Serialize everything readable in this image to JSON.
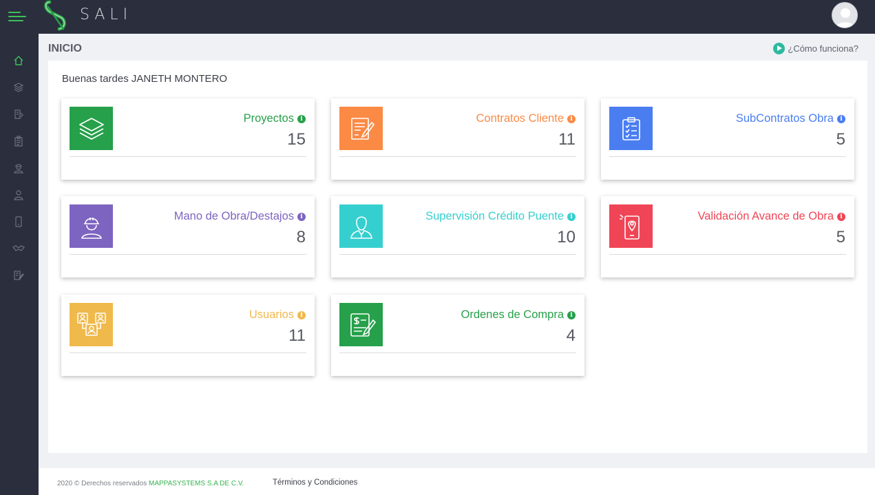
{
  "app": {
    "name": "SALI"
  },
  "header": {
    "page_title": "INICIO",
    "help_link": "¿Cómo funciona?"
  },
  "greeting": "Buenas tardes JANETH MONTERO",
  "cards": [
    {
      "title": "Proyectos",
      "count": "15",
      "color": "#26a04a",
      "icon": "layers-icon"
    },
    {
      "title": "Contratos Cliente",
      "count": "11",
      "color": "#fb8a45",
      "icon": "contract-icon"
    },
    {
      "title": "SubContratos Obra",
      "count": "5",
      "color": "#4a7ef0",
      "icon": "clipboard-checklist-icon"
    },
    {
      "title": "Mano de Obra/Destajos",
      "count": "8",
      "color": "#7d64c1",
      "icon": "worker-icon"
    },
    {
      "title": "Supervisión Crédito Puente",
      "count": "10",
      "color": "#36cfcf",
      "icon": "supervisor-icon"
    },
    {
      "title": "Validación Avance de Obra",
      "count": "5",
      "color": "#ef4556",
      "icon": "phone-location-icon"
    },
    {
      "title": "Usuarios",
      "count": "11",
      "color": "#f0b94c",
      "icon": "users-icon"
    },
    {
      "title": "Ordenes de Compra",
      "count": "4",
      "color": "#26a04a",
      "icon": "purchase-order-icon"
    }
  ],
  "sidebar": {
    "items": [
      {
        "icon": "home-icon",
        "active": true
      },
      {
        "icon": "layers-icon"
      },
      {
        "icon": "contract-icon"
      },
      {
        "icon": "clipboard-icon"
      },
      {
        "icon": "worker-icon"
      },
      {
        "icon": "supervisor-icon"
      },
      {
        "icon": "phone-icon"
      },
      {
        "icon": "handshake-icon"
      },
      {
        "icon": "edit-document-icon"
      }
    ]
  },
  "footer": {
    "copyright": "2020 © Derechos reservados",
    "company": "MAPPASYSTEMS S.A DE C.V.",
    "terms": "Términos y Condiciones"
  },
  "colors": {
    "brand_green": "#3ec15a",
    "topbar": "#2b2e3d",
    "background": "#eff1f5"
  }
}
